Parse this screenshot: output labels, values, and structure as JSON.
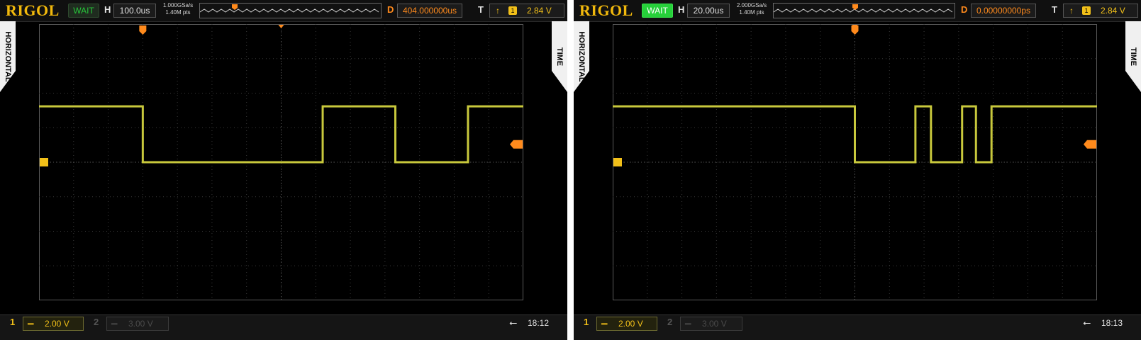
{
  "screens": [
    {
      "brand": "RIGOL",
      "status": "WAIT",
      "status_style": "dim",
      "horizontal_label": "H",
      "timebase": "100.0us",
      "sample_rate": "1.000GSa/s",
      "memory_depth": "1.40M pts",
      "delay_label": "D",
      "delay": "404.000000us",
      "trigger_label": "T",
      "trigger_edge": "↑",
      "trigger_channel": "1",
      "trigger_level": "2.84 V",
      "left_tab": "HORIZONTAL",
      "right_tab": "TIME",
      "ch1_label": "1",
      "ch1_coupling": "═",
      "ch1_scale": "2.00 V",
      "ch2_label": "2",
      "ch2_coupling": "═",
      "ch2_scale": "3.00 V",
      "usb_icon": "usb-icon",
      "time": "18:12",
      "trace_color": "#c8c83c",
      "trace": {
        "x_range": [
          0,
          14
        ],
        "high": 2.84,
        "low": 0,
        "transitions": [
          3.0,
          8.2,
          10.3,
          12.4
        ],
        "initial_state": "high"
      },
      "trigger_marker_x": 3.0
    },
    {
      "brand": "RIGOL",
      "status": "WAIT",
      "status_style": "bright",
      "horizontal_label": "H",
      "timebase": "20.00us",
      "sample_rate": "2.000GSa/s",
      "memory_depth": "1.40M pts",
      "delay_label": "D",
      "delay": "0.00000000ps",
      "trigger_label": "T",
      "trigger_edge": "↑",
      "trigger_channel": "1",
      "trigger_level": "2.84 V",
      "left_tab": "HORIZONTAL",
      "right_tab": "TIME",
      "ch1_label": "1",
      "ch1_coupling": "═",
      "ch1_scale": "2.00 V",
      "ch2_label": "2",
      "ch2_coupling": "═",
      "ch2_scale": "3.00 V",
      "usb_icon": "usb-icon",
      "time": "18:13",
      "trace_color": "#c8c83c",
      "trace": {
        "x_range": [
          0,
          14
        ],
        "high": 2.84,
        "low": 0,
        "transitions": [
          7.0,
          8.75,
          9.2,
          10.1,
          10.5,
          10.95
        ],
        "initial_state": "high"
      },
      "trigger_marker_x": 7.0
    }
  ]
}
